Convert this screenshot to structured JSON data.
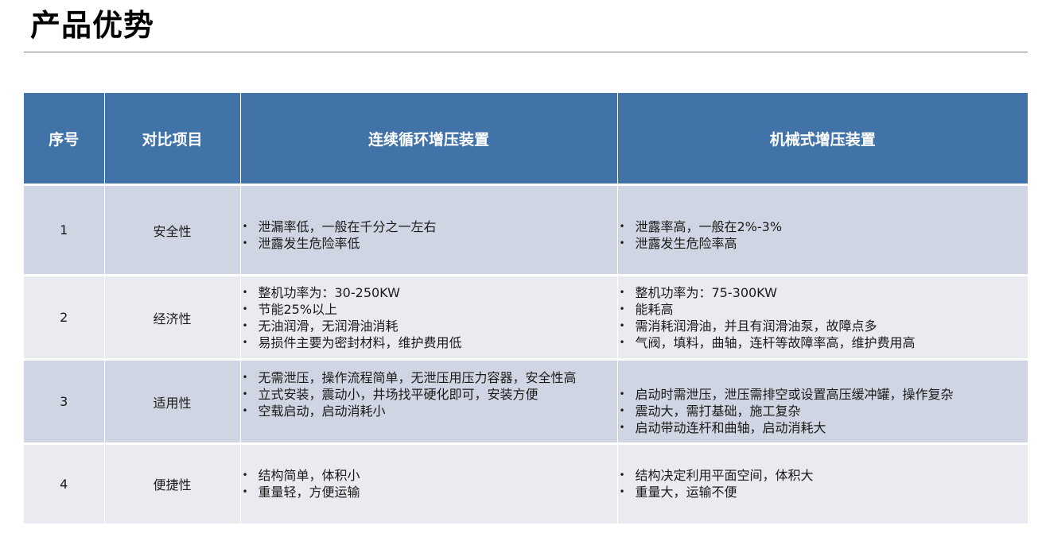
{
  "title": "产品优势",
  "table": {
    "headers": [
      "序号",
      "对比项目",
      "连续循环增压装置",
      "机械式增压装置"
    ],
    "rows": [
      {
        "no": "1",
        "item": "安全性",
        "continuous": [
          "泄漏率低，一般在千分之一左右",
          "泄露发生危险率低"
        ],
        "mechanical": [
          "泄露率高，一般在2%-3%",
          "泄露发生危险率高"
        ]
      },
      {
        "no": "2",
        "item": "经济性",
        "continuous": [
          "整机功率为：30-250KW",
          "节能25%以上",
          "无油润滑，无润滑油消耗",
          "易损件主要为密封材料，维护费用低"
        ],
        "mechanical": [
          "整机功率为：75-300KW",
          "能耗高",
          "需消耗润滑油，并且有润滑油泵，故障点多",
          "气阀，填料，曲轴，连杆等故障率高，维护费用高"
        ]
      },
      {
        "no": "3",
        "item": "适用性",
        "continuous": [
          "无需泄压，操作流程简单，无泄压用压力容器，安全性高",
          "立式安装，震动小，井场找平硬化即可，安装方便",
          "空载启动，启动消耗小"
        ],
        "mechanical": [
          "启动时需泄压，泄压需排空或设置高压缓冲罐，操作复杂",
          "震动大，需打基础，施工复杂",
          "启动带动连杆和曲轴，启动消耗大"
        ]
      },
      {
        "no": "4",
        "item": "便捷性",
        "continuous": [
          "结构简单，体积小",
          "重量轻，方便运输"
        ],
        "mechanical": [
          "结构决定利用平面空间，体积大",
          "重量大，运输不便"
        ]
      }
    ]
  }
}
